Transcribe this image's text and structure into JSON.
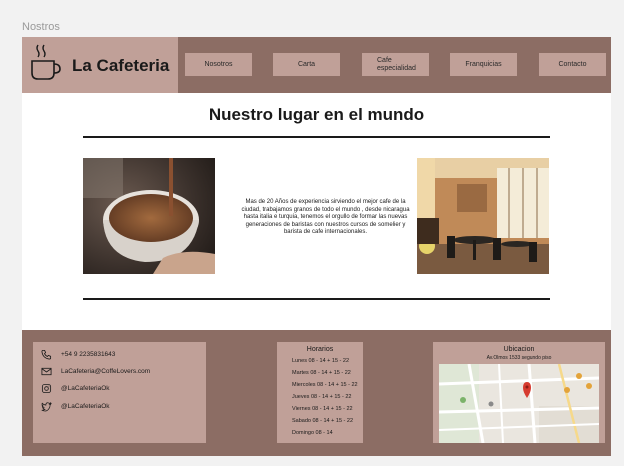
{
  "frame_label": "Nostros",
  "brand": {
    "name": "La Cafeteria",
    "icon": "coffee-cup-icon"
  },
  "nav": {
    "items": [
      {
        "label": "Nosotros"
      },
      {
        "label": "Carta"
      },
      {
        "label": "Cafe\nespecialidad"
      },
      {
        "label": "Franquicias"
      },
      {
        "label": "Contacto"
      }
    ]
  },
  "main": {
    "title": "Nuestro lugar en el mundo",
    "description": "Mas de 20 Años de experiencia sirviendo el mejor cafe de la ciudad, trabajamos granos de todo el mundo , desde nicaragua hasta italia e turquia, tenemos el orgullo de formar las nuevas generaciones de baristas con nuestros cursos de somelier y barista de cafe internacionales.",
    "left_image": "coffee-cup-pour-photo",
    "right_image": "cafe-interior-photo"
  },
  "footer": {
    "contact": [
      {
        "icon": "phone-icon",
        "text": "+54 9 2235831643"
      },
      {
        "icon": "mail-icon",
        "text": "LaCafeteria@CoffeLovers.com"
      },
      {
        "icon": "instagram-icon",
        "text": "@LaCafeteriaOk"
      },
      {
        "icon": "twitter-icon",
        "text": "@LaCafeteriaOk"
      }
    ],
    "hours": {
      "title": "Horarios",
      "rows": [
        "Lunes 08 - 14 + 15 - 22",
        "Martes 08 - 14 + 15 - 22",
        "Miercoles 08 - 14 + 15 - 22",
        "Jueves 08 - 14 + 15 - 22",
        "Viernes 08 - 14 + 15 - 22",
        "Sabado 08 - 14 + 15 - 22",
        "Domingo 08 - 14"
      ]
    },
    "location": {
      "title": "Ubicacion",
      "address": "Av.Olmos 1533 segundo piso",
      "map": "map-image"
    }
  },
  "colors": {
    "header_bg": "#8c6d64",
    "button_bg": "#c0a098",
    "text": "#1a1a1a"
  }
}
